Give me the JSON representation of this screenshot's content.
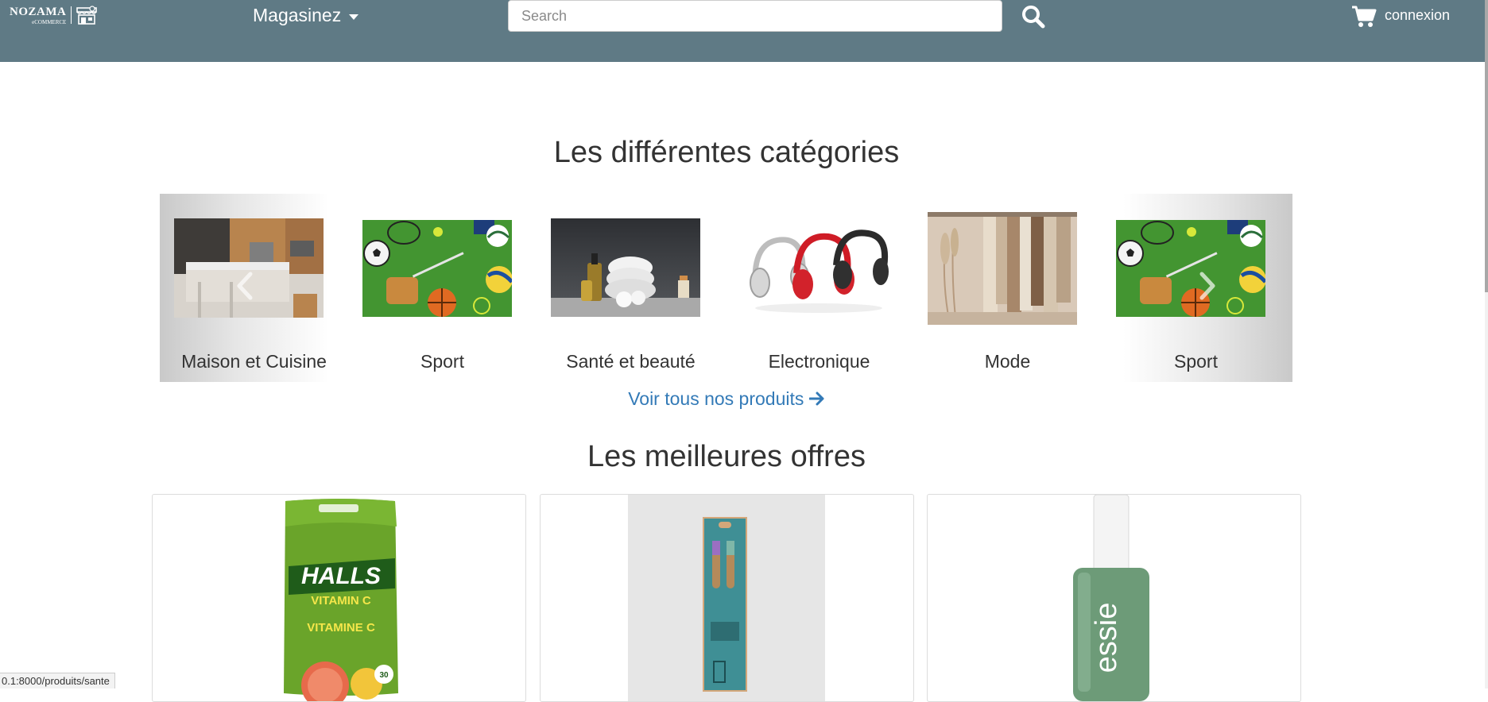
{
  "header": {
    "logo_text": "NOZAMA",
    "logo_sub": "eCOMMERCE",
    "shop_label": "Magasinez",
    "search_placeholder": "Search",
    "login_label": "connexion"
  },
  "categories": {
    "title": "Les différentes catégories",
    "items": [
      {
        "label": "Maison et Cuisine"
      },
      {
        "label": "Sport"
      },
      {
        "label": "Santé et beauté"
      },
      {
        "label": "Electronique"
      },
      {
        "label": "Mode"
      },
      {
        "label": "Sport"
      }
    ],
    "all_products_link": "Voir tous nos produits"
  },
  "offers": {
    "title": "Les meilleures offres",
    "products": [
      {
        "name": "HALLS Vitamin C",
        "brand": "HALLS",
        "line1": "VITAMIN C",
        "line2": "VITAMINE C",
        "count": "30"
      },
      {
        "name": "Bamboo toothbrush"
      },
      {
        "name": "essie nail polish",
        "brand": "essie"
      }
    ]
  },
  "status_bar": {
    "url": "0.1:8000/produits/sante"
  },
  "colors": {
    "navbar": "#5f7a85",
    "link": "#337ab7"
  }
}
